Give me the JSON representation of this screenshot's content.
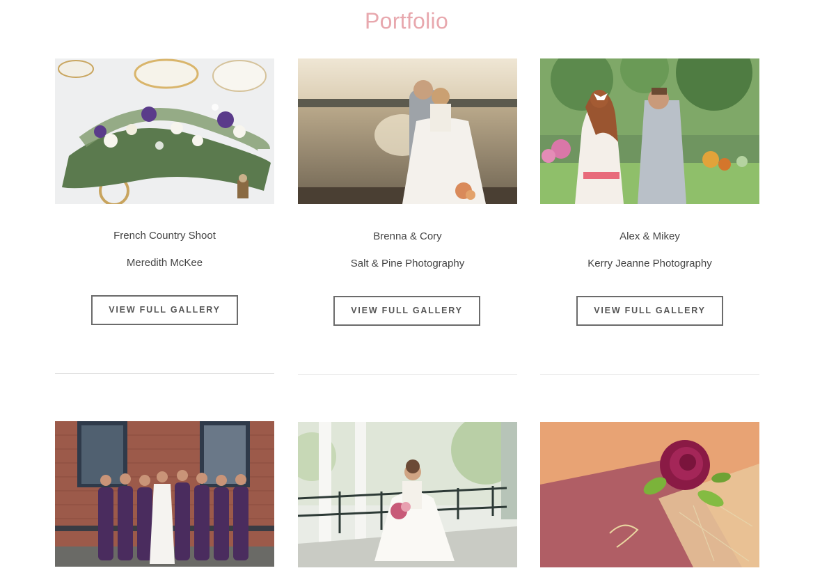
{
  "page": {
    "title": "Portfolio"
  },
  "galleries": [
    {
      "title": "French Country Shoot",
      "photographer": "Meredith McKee",
      "button_label": "VIEW FULL GALLERY",
      "photo": "floral-centerpiece-photo"
    },
    {
      "title": "Brenna & Cory",
      "photographer": "Salt & Pine Photography",
      "button_label": "VIEW FULL GALLERY",
      "photo": "couple-waterfront-photo"
    },
    {
      "title": "Alex & Mikey",
      "photographer": "Kerry Jeanne Photography",
      "button_label": "VIEW FULL GALLERY",
      "photo": "couple-garden-photo"
    },
    {
      "photo": "bridal-party-brick-photo"
    },
    {
      "photo": "bride-porch-photo"
    },
    {
      "photo": "rose-boutonniere-photo"
    }
  ],
  "colors": {
    "title_accent": "#e8a8ae",
    "button_border": "#6b6b6b",
    "divider": "#e3e3e3"
  }
}
